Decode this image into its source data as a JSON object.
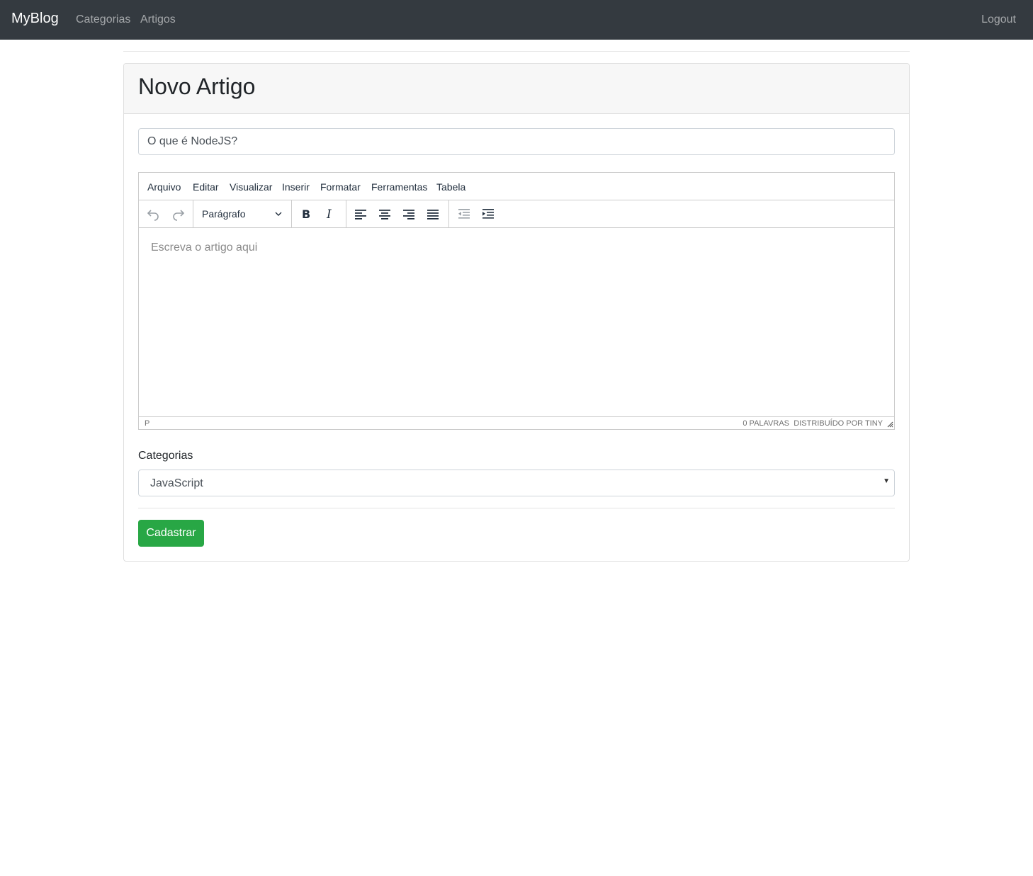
{
  "navbar": {
    "brand": "MyBlog",
    "links": [
      "Categorias",
      "Artigos"
    ],
    "logout": "Logout"
  },
  "card": {
    "title": "Novo Artigo"
  },
  "form": {
    "title_value": "O que é NodeJS?",
    "editor": {
      "menu": [
        "Arquivo",
        "Editar",
        "Visualizar",
        "Inserir",
        "Formatar",
        "Ferramentas",
        "Tabela"
      ],
      "block_format": "Parágrafo",
      "placeholder": "Escreva o artigo aqui",
      "status_path": "P",
      "word_count": "0 PALAVRAS",
      "branding": "DISTRIBUÍDO POR TINY"
    },
    "category_label": "Categorias",
    "category_value": "JavaScript",
    "submit_label": "Cadastrar"
  },
  "colors": {
    "navbar_bg": "#343a40",
    "submit_bg": "#28a745"
  }
}
